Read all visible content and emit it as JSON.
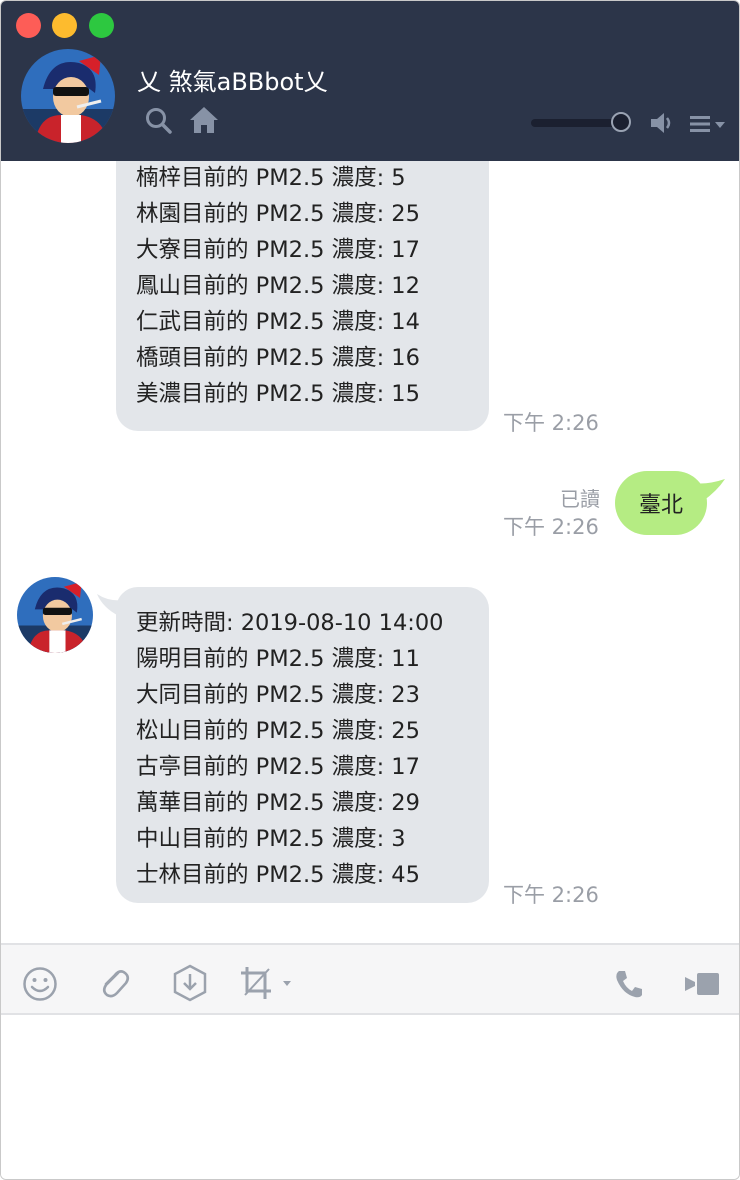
{
  "header": {
    "title": "乂 煞氣aBBbot乂",
    "volume": 0.88
  },
  "messages": {
    "first": {
      "lines": [
        "楠梓目前的 PM2.5 濃度: 5",
        "林園目前的 PM2.5 濃度: 25",
        "大寮目前的 PM2.5 濃度: 17",
        "鳳山目前的 PM2.5 濃度: 12",
        "仁武目前的 PM2.5 濃度: 14",
        "橋頭目前的 PM2.5 濃度: 16",
        "美濃目前的 PM2.5 濃度: 15"
      ],
      "time": "下午 2:26"
    },
    "sent": {
      "text": "臺北",
      "read": "已讀",
      "time": "下午 2:26"
    },
    "second": {
      "lines": [
        "更新時間: 2019-08-10 14:00",
        "陽明目前的 PM2.5 濃度: 11",
        "大同目前的 PM2.5 濃度: 23",
        "松山目前的 PM2.5 濃度: 25",
        "古亭目前的 PM2.5 濃度: 17",
        "萬華目前的 PM2.5 濃度: 29",
        "中山目前的 PM2.5 濃度: 3",
        "士林目前的 PM2.5 濃度: 45"
      ],
      "time": "下午 2:26"
    }
  },
  "icons": {
    "header": [
      "search-icon",
      "home-icon",
      "speaker-icon",
      "menu-icon"
    ],
    "toolbar": [
      "emoji-icon",
      "attachment-icon",
      "download-icon",
      "crop-icon",
      "phone-icon",
      "video-icon"
    ]
  },
  "colors": {
    "header_bg": "#2c3549",
    "bubble_in": "#e3e6ea",
    "bubble_out": "#b5ec83",
    "timestamp": "#9a9ea6"
  }
}
